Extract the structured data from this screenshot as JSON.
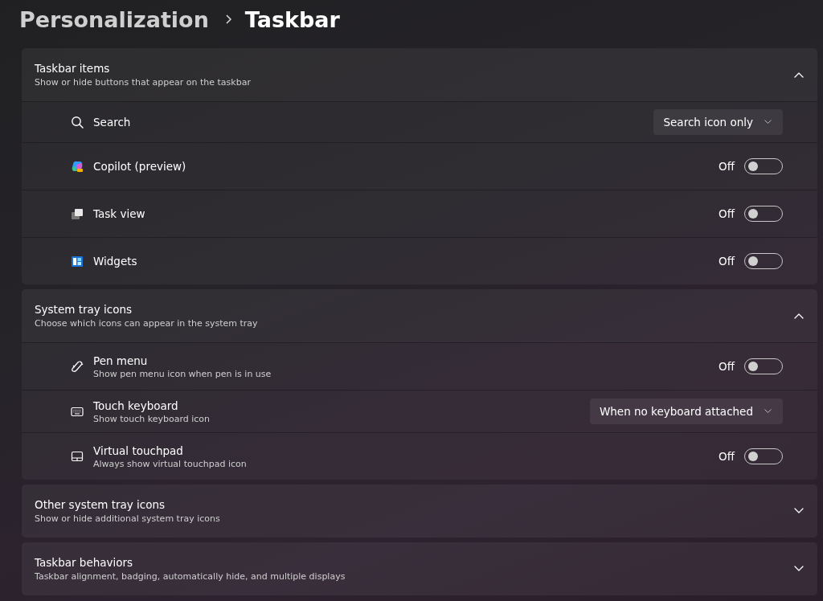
{
  "breadcrumb": {
    "parent": "Personalization",
    "current": "Taskbar"
  },
  "sections": [
    {
      "title": "Taskbar items",
      "subtitle": "Show or hide buttons that appear on the taskbar",
      "expanded": true,
      "items": [
        {
          "kind": "dropdown",
          "label": "Search",
          "value": "Search icon only"
        },
        {
          "kind": "toggle",
          "label": "Copilot (preview)",
          "on": false,
          "state_label": "Off"
        },
        {
          "kind": "toggle",
          "label": "Task view",
          "on": false,
          "state_label": "Off"
        },
        {
          "kind": "toggle",
          "label": "Widgets",
          "on": false,
          "state_label": "Off"
        }
      ]
    },
    {
      "title": "System tray icons",
      "subtitle": "Choose which icons can appear in the system tray",
      "expanded": true,
      "items": [
        {
          "kind": "toggle",
          "label": "Pen menu",
          "description": "Show pen menu icon when pen is in use",
          "on": false,
          "state_label": "Off"
        },
        {
          "kind": "dropdown",
          "label": "Touch keyboard",
          "description": "Show touch keyboard icon",
          "value": "When no keyboard attached"
        },
        {
          "kind": "toggle",
          "label": "Virtual touchpad",
          "description": "Always show virtual touchpad icon",
          "on": false,
          "state_label": "Off"
        }
      ]
    },
    {
      "title": "Other system tray icons",
      "subtitle": "Show or hide additional system tray icons",
      "expanded": false
    },
    {
      "title": "Taskbar behaviors",
      "subtitle": "Taskbar alignment, badging, automatically hide, and multiple displays",
      "expanded": false
    }
  ]
}
